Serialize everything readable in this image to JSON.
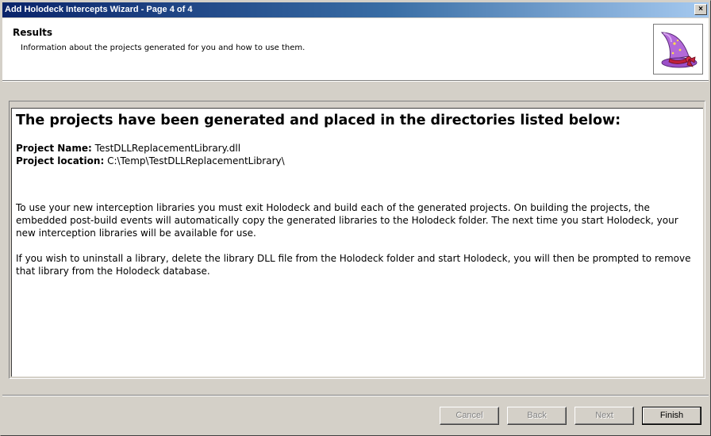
{
  "window": {
    "title": "Add Holodeck Intercepts Wizard - Page 4 of 4",
    "close_glyph": "×"
  },
  "header": {
    "title": "Results",
    "subtitle": "Information about the projects generated for you and how to use them.",
    "icon": "wizard-hat-icon"
  },
  "content": {
    "heading": "The projects have been generated and placed in the directories listed below:",
    "project_name_label": "Project Name:",
    "project_name_value": "TestDLLReplacementLibrary.dll",
    "project_location_label": "Project location:",
    "project_location_value": "C:\\Temp\\TestDLLReplacementLibrary\\",
    "paragraph1": "To use your new interception libraries you must exit Holodeck and build each of the generated projects. On building the projects, the embedded post-build events will automatically copy the generated libraries to the Holodeck folder. The next time you start Holodeck, your new interception libraries will be available for use.",
    "paragraph2": "If you wish to uninstall a library, delete the library DLL file from the Holodeck folder and start Holodeck, you will then be prompted to remove that library from the Holodeck database."
  },
  "buttons": {
    "cancel": "Cancel",
    "back": "Back",
    "next": "Next",
    "finish": "Finish"
  },
  "colors": {
    "titlebar_start": "#0a246a",
    "titlebar_end": "#a6caf0",
    "face": "#d4d0c8"
  }
}
